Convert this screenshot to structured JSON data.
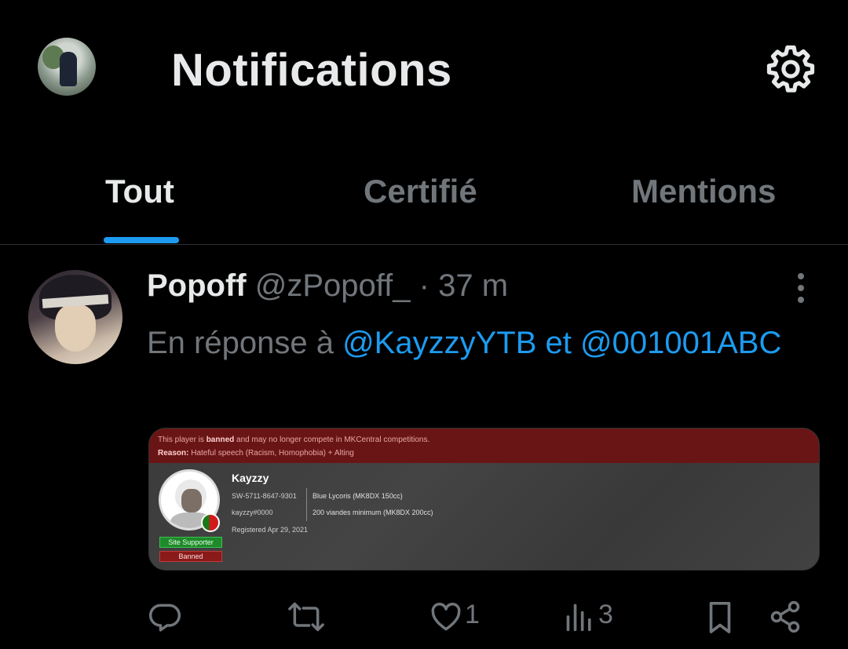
{
  "header": {
    "title": "Notifications",
    "settings_icon": "gear-icon"
  },
  "tabs": [
    {
      "label": "Tout",
      "active": true
    },
    {
      "label": "Certifié",
      "active": false
    },
    {
      "label": "Mentions",
      "active": false
    }
  ],
  "tweet": {
    "name": "Popoff",
    "handle": "@zPopoff_",
    "separator": "·",
    "time": "37 m",
    "reply_prefix": "En réponse à",
    "mention_1": "@KayzzyYTB",
    "reply_joiner": "et",
    "mention_2": "@001001ABC",
    "media": {
      "banner_line1_pre": "This player is ",
      "banner_line1_bold": "banned",
      "banner_line1_post": " and may no longer compete in MKCentral competitions.",
      "banner_line2_bold": "Reason:",
      "banner_line2_post": " Hateful speech (Racism, Homophobia) + Alting",
      "player_name": "Kayzzy",
      "friend_code": "SW-5711-8647-9301",
      "discord": "kayzzy#0000",
      "registered": "Registered Apr 29, 2021",
      "team_1": "Blue Lycoris (MK8DX 150cc)",
      "team_2": "200 viandes minimum (MK8DX 200cc)",
      "badge_1": "Site Supporter",
      "badge_2": "Banned"
    },
    "actions": {
      "reply_count": "",
      "retweet_count": "",
      "like_count": "1",
      "views_count": "3"
    }
  },
  "colors": {
    "background": "#000000",
    "accent": "#1d9bf0",
    "muted": "#71767b",
    "text": "#e7e9ea"
  }
}
